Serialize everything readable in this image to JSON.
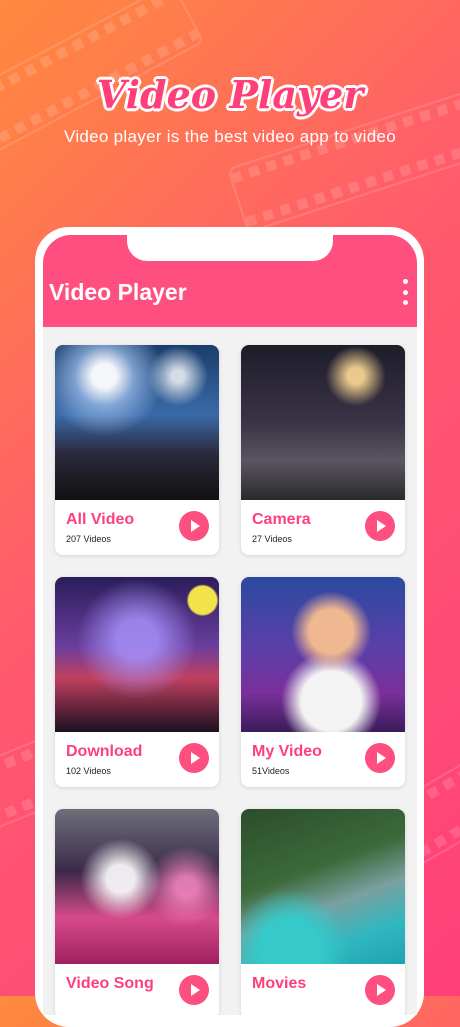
{
  "hero": {
    "title": "Video Player",
    "subtitle": "Video player is the best video app to video"
  },
  "app": {
    "title": "Video Player",
    "accent_color": "#ff4f80",
    "menu_icon": "more-vertical-icon"
  },
  "folders": [
    {
      "title": "All Video",
      "count": "207 Videos"
    },
    {
      "title": "Camera",
      "count": "27 Videos"
    },
    {
      "title": "Download",
      "count": "102 Videos"
    },
    {
      "title": "My Video",
      "count": "51Videos"
    },
    {
      "title": "Video Song",
      "count": ""
    },
    {
      "title": "Movies",
      "count": ""
    }
  ]
}
